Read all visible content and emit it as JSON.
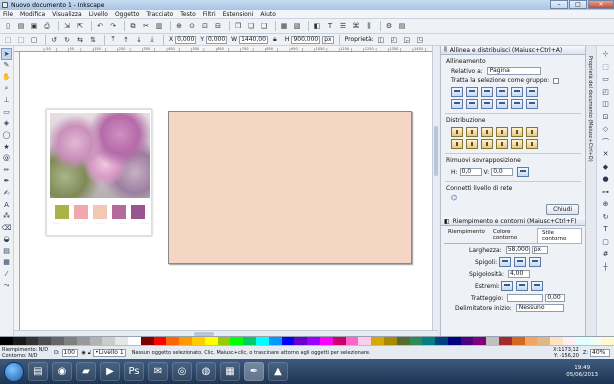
{
  "window": {
    "title": "Nuovo documento 1 - Inkscape",
    "minimize": "–",
    "maximize": "□",
    "close": "✕"
  },
  "menu": [
    "File",
    "Modifica",
    "Visualizza",
    "Livello",
    "Oggetto",
    "Tracciato",
    "Testo",
    "Filtri",
    "Estensioni",
    "Aiuto"
  ],
  "controls": {
    "x_label": "X",
    "x_value": "0,000",
    "y_label": "Y",
    "y_value": "0,000",
    "w_label": "W",
    "w_value": "1440,00",
    "h_label": "H",
    "h_value": "900,000",
    "unit": "px",
    "props_label": "Proprietà:"
  },
  "ruler_ticks": [
    "-50",
    "0",
    "50",
    "100",
    "150",
    "200",
    "250",
    "300",
    "350",
    "400",
    "450",
    "500",
    "550",
    "600",
    "650",
    "700",
    "750",
    "800",
    "850",
    "900",
    "950",
    "1000",
    "1050",
    "1100",
    "1150",
    "1200",
    "1250",
    "1300",
    "1350",
    "1400",
    "1450",
    "1500"
  ],
  "swatch_card": {
    "labels": [
      "........",
      "........",
      "........",
      "........",
      "........"
    ]
  },
  "align_panel": {
    "header": "Allinea e distribuisci (Maiusc+Ctrl+A)",
    "alignment": "Allineamento",
    "relative_label": "Relativo a:",
    "relative_value": "Pagina",
    "treat_group": "Tratta la selezione come gruppo:",
    "distribution": "Distribuzione",
    "remove_overlap": "Rimuovi sovrapposizione",
    "h_label": "H:",
    "h_value": "0,0",
    "v_label": "V:",
    "v_value": "0,0",
    "connect": "Connetti livello di rete",
    "close_btn": "Chiudi"
  },
  "fill_panel": {
    "header": "Riempimento e contorni (Maiusc+Ctrl+F)",
    "tabs": [
      "Riempimento",
      "Colore contorno",
      "Stile contorno"
    ],
    "width_label": "Larghezza:",
    "width_value": "58,000",
    "width_unit": "px",
    "join_label": "Spigoli:",
    "miter_label": "Spigolosità:",
    "miter_value": "4,00",
    "cap_label": "Estremi:",
    "dash_label": "Tratteggio:",
    "dash_value": "0,00",
    "start_label": "Delimitatore inizio:",
    "start_value": "Nessuno"
  },
  "side_tab": "Proprietà del documento (Maiusc+Ctrl+D)",
  "status": {
    "fill_label": "Riempimento:",
    "fill_value": "N/D",
    "stroke_label": "Contorno:",
    "stroke_value": "N/D",
    "opacity_label": "O:",
    "opacity_value": "100",
    "layer": "•Livello 1",
    "message": "Nessun oggetto selezionato. Clic, Maiusc+clic, o trascinare attorno agli oggetti per selezionare.",
    "coord_x": "X:1173,12",
    "coord_y": "Y: -156,20",
    "zoom_label": "Z:",
    "zoom_value": "40%"
  },
  "taskbar": {
    "time": "19:49",
    "date": "05/06/2013"
  },
  "palette": [
    "#000000",
    "#1a1a1a",
    "#333333",
    "#4d4d4d",
    "#666666",
    "#808080",
    "#999999",
    "#b3b3b3",
    "#cccccc",
    "#e6e6e6",
    "#ffffff",
    "#800000",
    "#ff0000",
    "#ff6600",
    "#ff9900",
    "#ffcc00",
    "#ffff00",
    "#99cc00",
    "#00ff00",
    "#00cc66",
    "#00ffff",
    "#0099ff",
    "#0000ff",
    "#6600cc",
    "#9900ff",
    "#ff00ff",
    "#cc0066",
    "#ff66cc",
    "#ffccee",
    "#d4aa00",
    "#aa8800",
    "#556b2f",
    "#2e8b57",
    "#008080",
    "#004080",
    "#000080",
    "#4b0082",
    "#800080",
    "#c0c0c0",
    "#a52a2a",
    "#d2691e",
    "#f4a460",
    "#deb887",
    "#ffe4c4",
    "#fff0f5",
    "#e0ffff",
    "#f0fff0",
    "#fffacd"
  ],
  "colors": {
    "page_rect": "#f5d5c3",
    "chip1": "#a8b348",
    "chip2": "#f0a8ac",
    "chip3": "#f2c8b4",
    "chip4": "#b56a9c",
    "chip5": "#9a5590"
  }
}
